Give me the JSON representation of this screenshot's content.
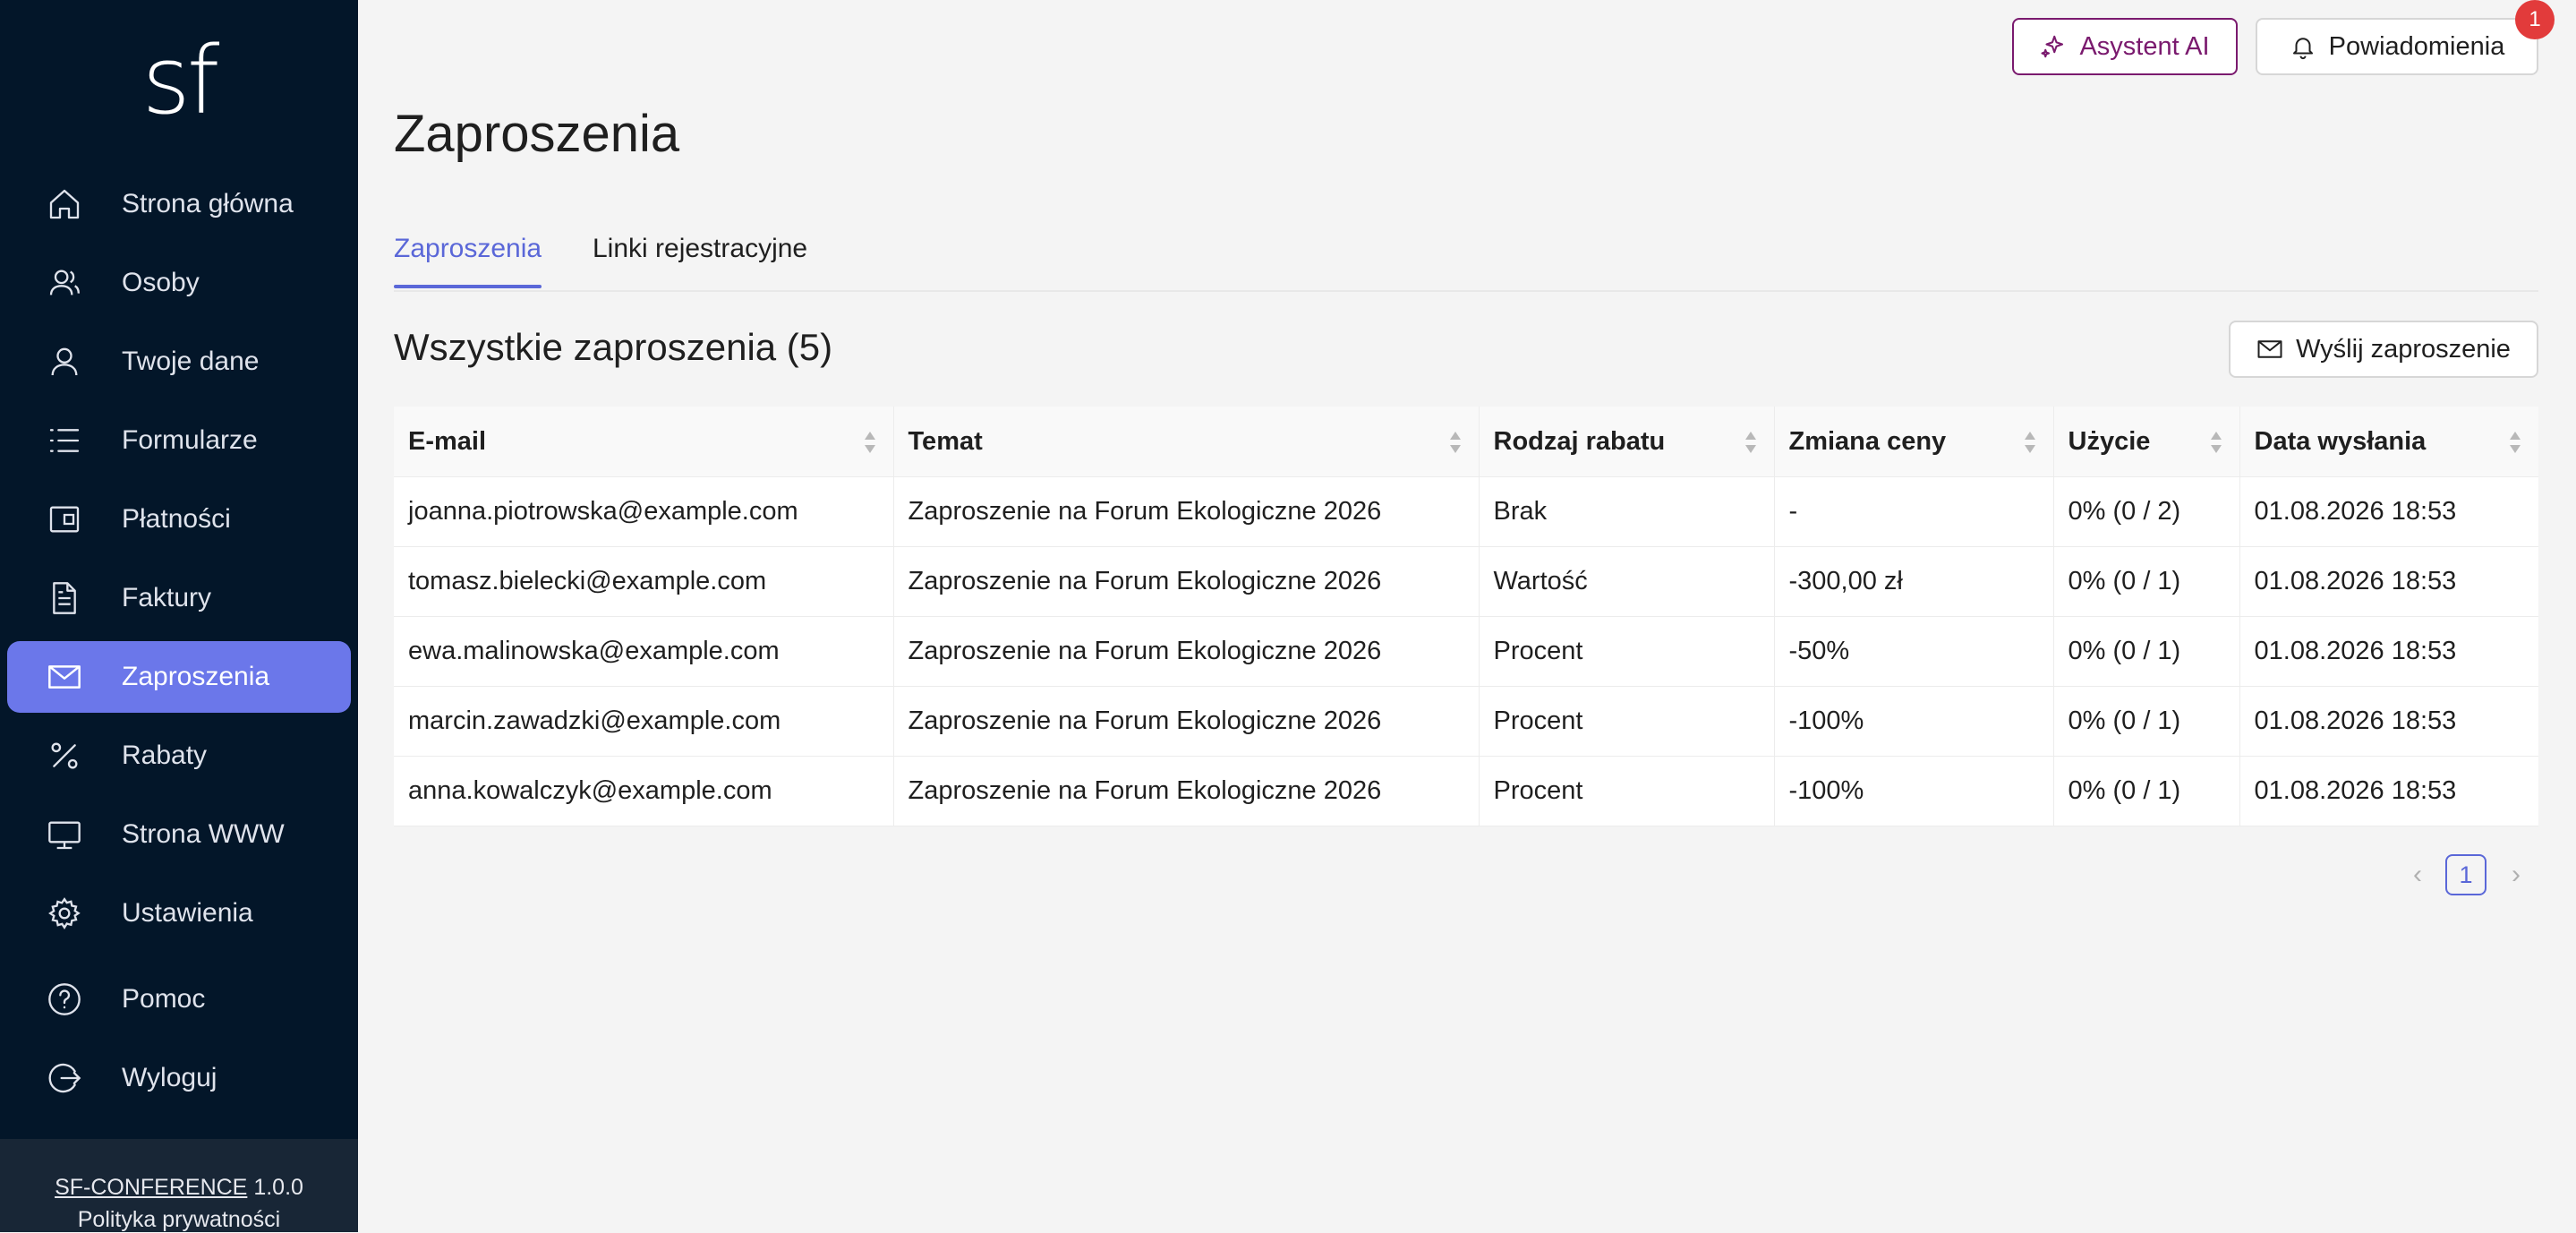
{
  "app": {
    "logo": "sf"
  },
  "sidebar": {
    "items": [
      {
        "label": "Strona główna",
        "icon": "home-icon",
        "active": false
      },
      {
        "label": "Osoby",
        "icon": "people-icon",
        "active": false
      },
      {
        "label": "Twoje dane",
        "icon": "user-icon",
        "active": false
      },
      {
        "label": "Formularze",
        "icon": "list-icon",
        "active": false
      },
      {
        "label": "Płatności",
        "icon": "wallet-icon",
        "active": false
      },
      {
        "label": "Faktury",
        "icon": "document-icon",
        "active": false
      },
      {
        "label": "Zaproszenia",
        "icon": "envelope-icon",
        "active": true
      },
      {
        "label": "Rabaty",
        "icon": "percent-icon",
        "active": false
      },
      {
        "label": "Strona WWW",
        "icon": "monitor-icon",
        "active": false
      },
      {
        "label": "Ustawienia",
        "icon": "gear-icon",
        "active": false
      },
      {
        "label": "Pomoc",
        "icon": "help-icon",
        "active": false
      },
      {
        "label": "Wyloguj",
        "icon": "logout-icon",
        "active": false
      }
    ],
    "footer": {
      "product": "SF-CONFERENCE",
      "version": "1.0.0",
      "privacy": "Polityka prywatności"
    }
  },
  "topbar": {
    "ai_label": "Asystent AI",
    "notifications_label": "Powiadomienia",
    "notifications_count": "1",
    "accent_color": "#7a1a6e"
  },
  "main": {
    "title": "Zaproszenia",
    "tabs": [
      {
        "label": "Zaproszenia",
        "active": true
      },
      {
        "label": "Linki rejestracyjne",
        "active": false
      }
    ],
    "section_title": "Wszystkie zaproszenia (5)",
    "send_label": "Wyślij zaproszenie"
  },
  "table": {
    "columns": [
      "E-mail",
      "Temat",
      "Rodzaj rabatu",
      "Zmiana ceny",
      "Użycie",
      "Data wysłania"
    ],
    "rows": [
      [
        "joanna.piotrowska@example.com",
        "Zaproszenie na Forum Ekologiczne 2026",
        "Brak",
        "-",
        "0% (0 / 2)",
        "01.08.2026 18:53"
      ],
      [
        "tomasz.bielecki@example.com",
        "Zaproszenie na Forum Ekologiczne 2026",
        "Wartość",
        "-300,00 zł",
        "0% (0 / 1)",
        "01.08.2026 18:53"
      ],
      [
        "ewa.malinowska@example.com",
        "Zaproszenie na Forum Ekologiczne 2026",
        "Procent",
        "-50%",
        "0% (0 / 1)",
        "01.08.2026 18:53"
      ],
      [
        "marcin.zawadzki@example.com",
        "Zaproszenie na Forum Ekologiczne 2026",
        "Procent",
        "-100%",
        "0% (0 / 1)",
        "01.08.2026 18:53"
      ],
      [
        "anna.kowalczyk@example.com",
        "Zaproszenie na Forum Ekologiczne 2026",
        "Procent",
        "-100%",
        "0% (0 / 1)",
        "01.08.2026 18:53"
      ]
    ]
  },
  "pagination": {
    "current": "1",
    "prev": "‹",
    "next": "›"
  },
  "colors": {
    "sidebar_bg": "#031629",
    "active_item": "#6b77ea",
    "tab_active": "#5a67d8",
    "badge": "#e23b3b"
  }
}
